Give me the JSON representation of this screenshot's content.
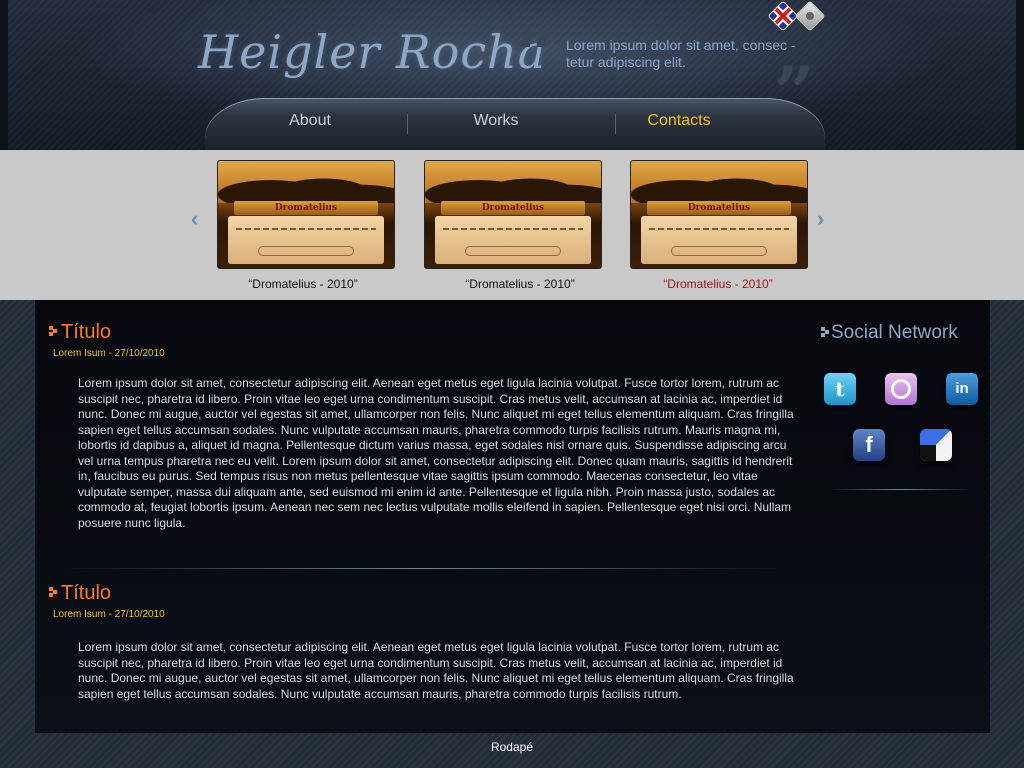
{
  "header": {
    "logo_text": "Heigler Rocha",
    "tagline": "Lorem ipsum dolor sit amet, consec - tetur adipiscing elit.",
    "quote_open": "“",
    "quote_close": "”",
    "languages": [
      "en-flag-icon",
      "language-icon"
    ]
  },
  "nav": {
    "items": [
      {
        "label": "About",
        "active": false
      },
      {
        "label": "Works",
        "active": false
      },
      {
        "label": "Contacts",
        "active": true
      }
    ],
    "active_color": "#f3c31c"
  },
  "gallery": {
    "prev_icon": "‹",
    "next_icon": "›",
    "items": [
      {
        "banner": "Dromatelius",
        "caption": "“Dromatelius - 2010”",
        "active": false
      },
      {
        "banner": "Dromatelius",
        "caption": "“Dromatelius - 2010”",
        "active": false
      },
      {
        "banner": "Dromatelius",
        "caption": "“Dromatelius - 2010”",
        "active": true
      }
    ]
  },
  "posts": [
    {
      "title": "Título",
      "date": "Lorem Isum - 27/10/2010",
      "body": "Lorem ipsum dolor sit amet, consectetur adipiscing elit. Aenean eget metus eget ligula lacinia volutpat. Fusce tortor lorem, rutrum ac suscipit nec, pharetra id libero. Proin vitae leo eget urna condimentum suscipit. Cras metus velit, accumsan at lacinia ac, imperdiet id nunc. Donec mi augue, auctor vel egestas sit amet, ullamcorper non felis. Nunc aliquet mi eget tellus elementum aliquam. Cras fringilla sapien eget tellus accumsan sodales. Nunc vulputate accumsan mauris, pharetra commodo turpis facilisis rutrum. Mauris magna mi, lobortis id dapibus a, aliquet id magna. Pellentesque dictum varius massa, eget sodales nisl ornare quis. Suspendisse adipiscing arcu vel urna tempus pharetra nec eu velit. Lorem ipsum dolor sit amet, consectetur adipiscing elit. Donec quam mauris, sagittis id hendrerit in, faucibus eu purus. Sed tempus risus non metus pellentesque vitae sagittis ipsum commodo. Maecenas consectetur, leo vitae vulputate semper, massa dui aliquam ante, sed euismod mi enim id ante. Pellentesque et ligula nibh. Proin massa justo, sodales ac commodo at, feugiat lobortis ipsum. Aenean nec sem nec lectus vulputate mollis eleifend in sapien. Pellentesque eget nisi orci. Nullam posuere nunc ligula."
    },
    {
      "title": "Título",
      "date": "Lorem Isum - 27/10/2010",
      "body": "Lorem ipsum dolor sit amet, consectetur adipiscing elit. Aenean eget metus eget ligula lacinia volutpat. Fusce tortor lorem, rutrum ac suscipit nec, pharetra id libero. Proin vitae leo eget urna condimentum suscipit. Cras metus velit, accumsan at lacinia ac, imperdiet id nunc. Donec mi augue, auctor vel egestas sit amet, ullamcorper non felis. Nunc aliquet mi eget tellus elementum aliquam. Cras fringilla sapien eget tellus accumsan sodales. Nunc vulputate accumsan mauris, pharetra commodo turpis facilisis rutrum."
    }
  ],
  "sidebar": {
    "title": "Social Network",
    "networks": [
      {
        "name": "twitter-icon",
        "glyph": "t",
        "color": "#36b7e6"
      },
      {
        "name": "flickr-icon",
        "glyph": "",
        "color": "#c78ad8"
      },
      {
        "name": "linkedin-icon",
        "glyph": "in",
        "color": "#1e78c2"
      },
      {
        "name": "facebook-icon",
        "glyph": "f",
        "color": "#3b5fa8"
      },
      {
        "name": "delicious-icon",
        "glyph": "",
        "color": "#2b5fd8"
      }
    ]
  },
  "footer": {
    "text": "Rodapé"
  },
  "colors": {
    "accent_orange": "#ff7d1e",
    "date_yellow": "#f5c32a",
    "caption_active": "#a0151a",
    "link_blue": "#8fa9c8"
  }
}
